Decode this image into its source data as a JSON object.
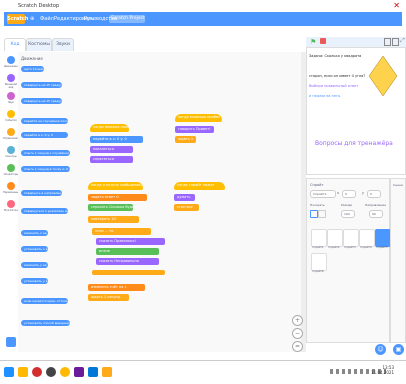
{
  "window": {
    "title": "Scratch Desktop",
    "close": "✕"
  },
  "menubar": {
    "logo": "Scratch",
    "items": [
      "Файл",
      "Редактировать",
      "Руководства"
    ],
    "project_title": "Scratch Project"
  },
  "tabs": [
    "Код",
    "Костюмы",
    "Звуки"
  ],
  "categories": [
    {
      "label": "Движение",
      "color": "#4c97ff"
    },
    {
      "label": "Внешний вид",
      "color": "#9966ff"
    },
    {
      "label": "Звук",
      "color": "#cf63cf"
    },
    {
      "label": "События",
      "color": "#ffbf00"
    },
    {
      "label": "Управление",
      "color": "#ffab19"
    },
    {
      "label": "Сенсоры",
      "color": "#5cb1d6"
    },
    {
      "label": "Операторы",
      "color": "#59c059"
    },
    {
      "label": "Переменные",
      "color": "#ff8c1a"
    },
    {
      "label": "Мои блоки",
      "color": "#ff6680"
    }
  ],
  "palette": {
    "heading": "Движение",
    "blocks": [
      "идти 10 шагов",
      "повернуть на 15 градусов",
      "повернуть на 15 градусов",
      "перейти на случайное положение",
      "перейти в x: 0 y: 0",
      "плыть 1 секунд к случайное положение",
      "плыть 1 секунд в точку x: 0 y: 0",
      "повернуть в направлении 90",
      "повернуться к указатель мыши",
      "изменить x на 10",
      "установить x в 0",
      "изменить y на 10",
      "установить y в 0",
      "если касается края, оттолкнуться",
      "установить способ вращения влево-вправо"
    ]
  },
  "scripts": [
    {
      "hat": "когда флажок нажат",
      "blocks": [
        "перейти в x: 0 y: 0",
        "показаться",
        "спрятаться"
      ]
    },
    {
      "hat": "когда клавиша пробел нажата",
      "blocks": [
        "говорить Привет!",
        "ждать 1"
      ]
    },
    {
      "hat": "когда я получу сообщение1",
      "blocks": [
        "задать ответ 0",
        "спросить Сколько будет...",
        "повторять 10",
        "если ... то",
        "сказать Правильно!",
        "иначе",
        "сказать Неправильно",
        "изменить счёт на 1",
        "ждать 1 секунд"
      ]
    },
    {
      "hat": "когда спрайт нажат",
      "blocks": [
        "думать",
        "стоп все"
      ]
    }
  ],
  "stage": {
    "lines": [
      "Задача: Сколько у квадрата",
      "сторон, если он имеет 4 угла?",
      "Выбери правильный ответ",
      "и нажми на него."
    ],
    "question": "Вопросы для тренажёра"
  },
  "sprite_info": {
    "sprite_label": "Спрайт",
    "sprite_name": "Спрайт1",
    "x_label": "x",
    "x_value": "0",
    "y_label": "y",
    "y_value": "0",
    "show_label": "Показать",
    "size_label": "Размер",
    "size_value": "100",
    "direction_label": "Направление",
    "direction_value": "90"
  },
  "sprites": [
    "Спрайт1",
    "Спрайт2",
    "Спрайт3",
    "Спрайт4",
    "Спрайт5",
    "Спрайт6"
  ],
  "stage_pane_label": "Сцена",
  "taskbar": {
    "time": "13:53",
    "date": "11.04.2021"
  }
}
